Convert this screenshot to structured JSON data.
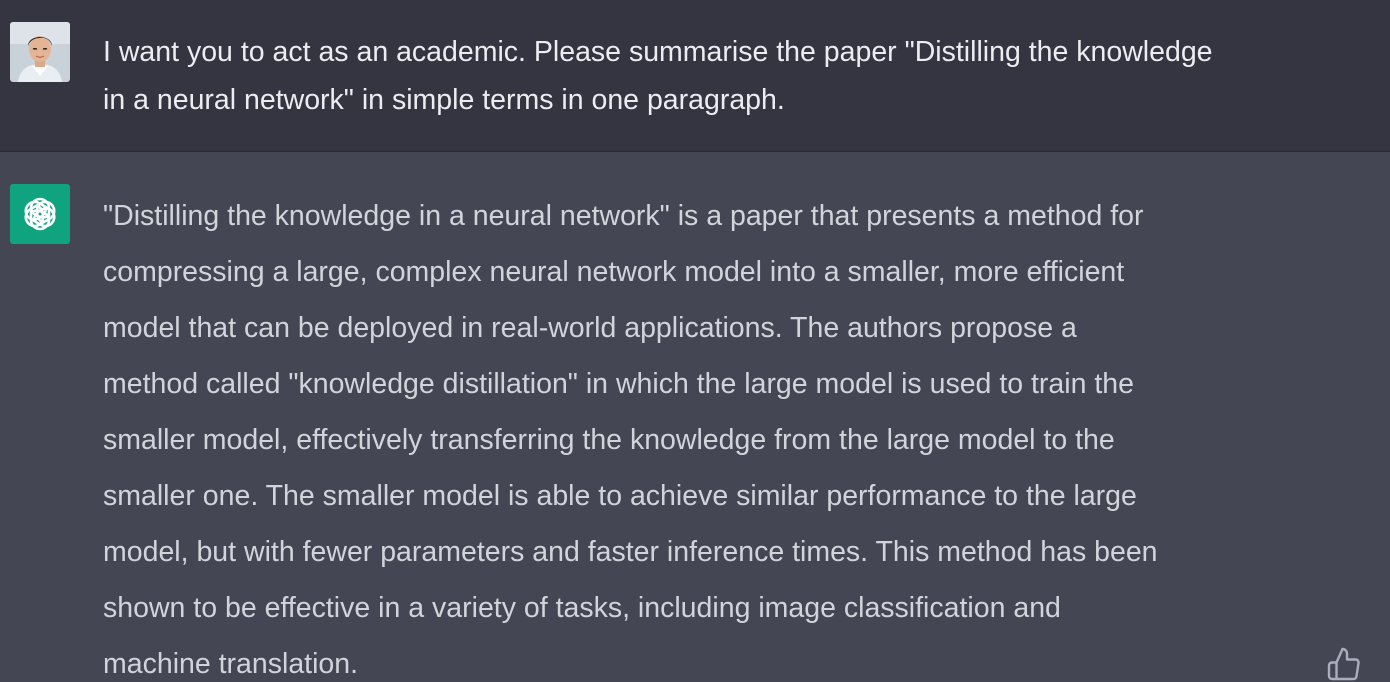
{
  "conversation": {
    "user_message": {
      "author_icon": "user-avatar-photo",
      "text": "I want you to act as an academic. Please summarise the paper \"Distilling the knowledge\nin a neural network\" in simple terms in one paragraph."
    },
    "assistant_message": {
      "author_icon": "openai-logo-icon",
      "text": "\"Distilling the knowledge in a neural network\" is a paper that presents a method for\ncompressing a large, complex neural network model into a smaller, more efficient\nmodel that can be deployed in real-world applications. The authors propose a\nmethod called \"knowledge distillation\" in which the large model is used to train the\nsmaller model, effectively transferring the knowledge from the large model to the\nsmaller one. The smaller model is able to achieve similar performance to the large\nmodel, but with fewer parameters and faster inference times. This method has been\nshown to be effective in a variety of tasks, including image classification and\nmachine translation.",
      "actions": [
        "thumbs-up-icon"
      ]
    }
  },
  "colors": {
    "user_background": "#343541",
    "assistant_background": "#444654",
    "assistant_avatar": "#10a37f"
  }
}
